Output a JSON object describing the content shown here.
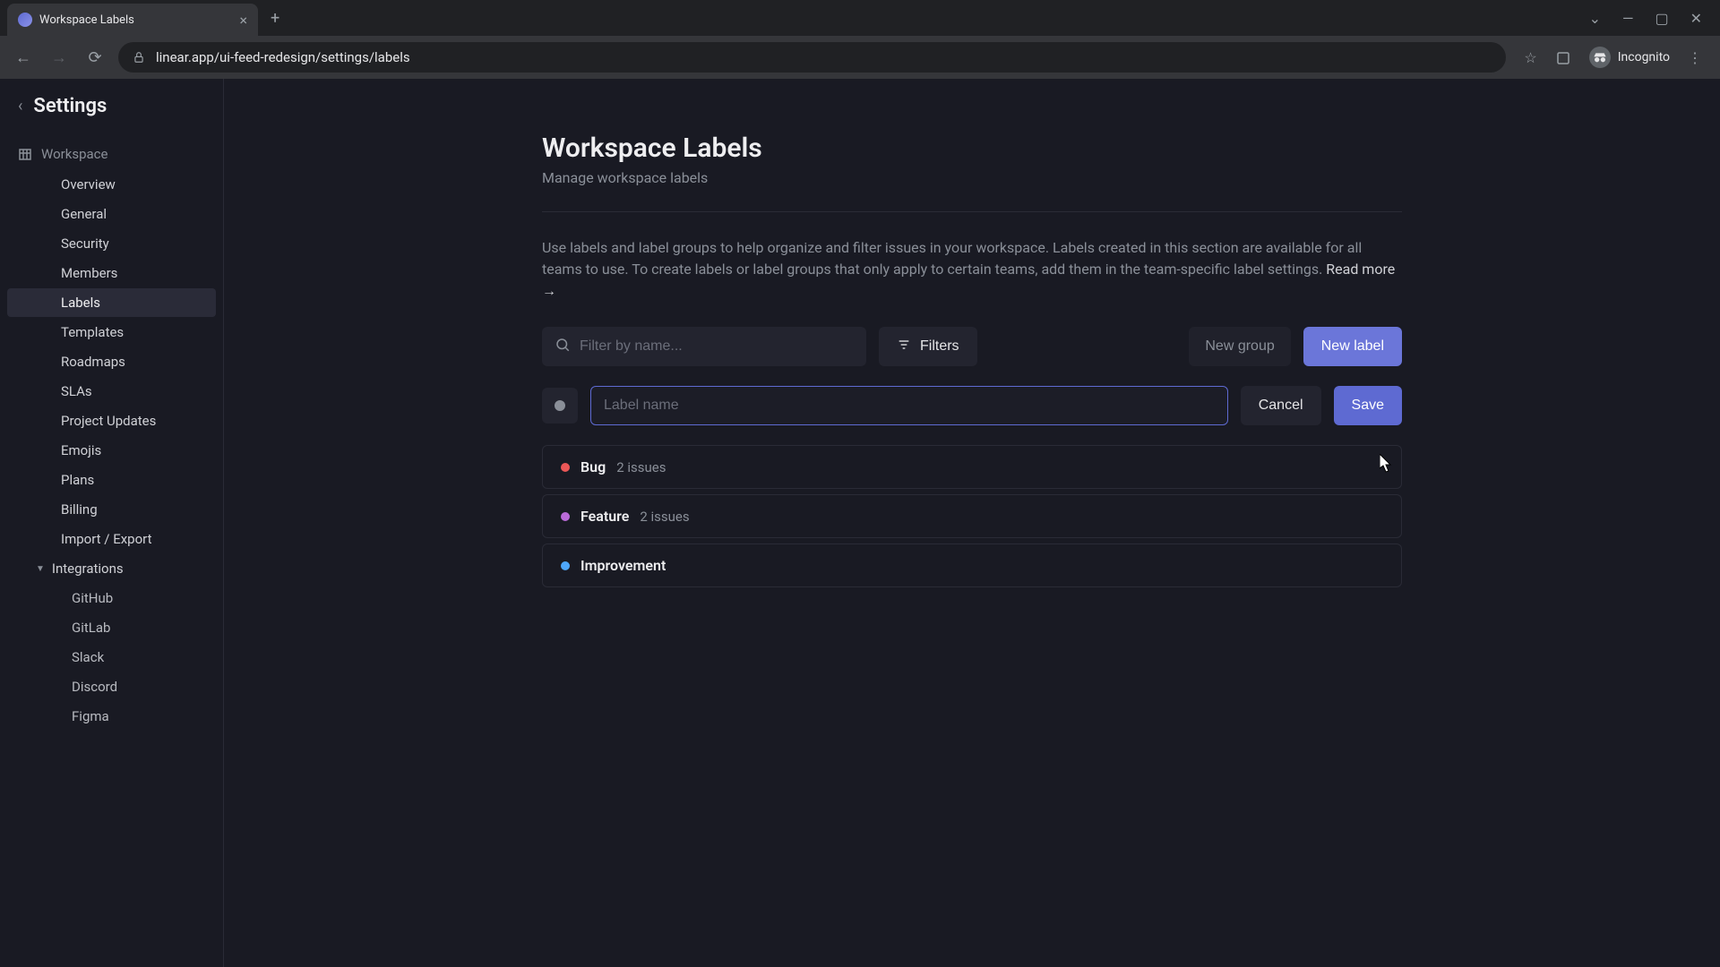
{
  "browser": {
    "tab_title": "Workspace Labels",
    "url": "linear.app/ui-feed-redesign/settings/labels",
    "incognito_label": "Incognito"
  },
  "sidebar": {
    "title": "Settings",
    "group_label": "Workspace",
    "items": [
      "Overview",
      "General",
      "Security",
      "Members",
      "Labels",
      "Templates",
      "Roadmaps",
      "SLAs",
      "Project Updates",
      "Emojis",
      "Plans",
      "Billing",
      "Import / Export"
    ],
    "integrations_label": "Integrations",
    "integrations": [
      "GitHub",
      "GitLab",
      "Slack",
      "Discord",
      "Figma"
    ]
  },
  "main": {
    "title": "Workspace Labels",
    "subtitle": "Manage workspace labels",
    "description": "Use labels and label groups to help organize and filter issues in your workspace. Labels created in this section are available for all teams to use. To create labels or label groups that only apply to certain teams, add them in the team-specific label settings. ",
    "read_more": "Read more →",
    "filter_placeholder": "Filter by name...",
    "filters_button": "Filters",
    "new_group_button": "New group",
    "new_label_button": "New label",
    "label_name_placeholder": "Label name",
    "cancel_button": "Cancel",
    "save_button": "Save",
    "labels": [
      {
        "name": "Bug",
        "count": "2 issues",
        "color": "#eb5757"
      },
      {
        "name": "Feature",
        "count": "2 issues",
        "color": "#bb6bd9"
      },
      {
        "name": "Improvement",
        "count": "",
        "color": "#4ea7fc"
      }
    ]
  }
}
